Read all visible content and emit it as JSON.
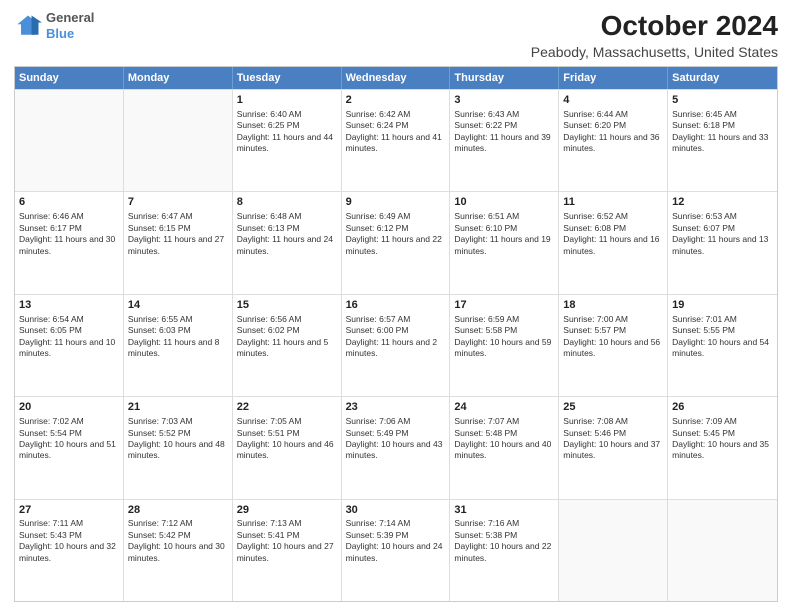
{
  "header": {
    "logo_line1": "General",
    "logo_line2": "Blue",
    "title": "October 2024",
    "subtitle": "Peabody, Massachusetts, United States"
  },
  "days_of_week": [
    "Sunday",
    "Monday",
    "Tuesday",
    "Wednesday",
    "Thursday",
    "Friday",
    "Saturday"
  ],
  "weeks": [
    [
      {
        "day": "",
        "info": ""
      },
      {
        "day": "",
        "info": ""
      },
      {
        "day": "1",
        "info": "Sunrise: 6:40 AM\nSunset: 6:25 PM\nDaylight: 11 hours and 44 minutes."
      },
      {
        "day": "2",
        "info": "Sunrise: 6:42 AM\nSunset: 6:24 PM\nDaylight: 11 hours and 41 minutes."
      },
      {
        "day": "3",
        "info": "Sunrise: 6:43 AM\nSunset: 6:22 PM\nDaylight: 11 hours and 39 minutes."
      },
      {
        "day": "4",
        "info": "Sunrise: 6:44 AM\nSunset: 6:20 PM\nDaylight: 11 hours and 36 minutes."
      },
      {
        "day": "5",
        "info": "Sunrise: 6:45 AM\nSunset: 6:18 PM\nDaylight: 11 hours and 33 minutes."
      }
    ],
    [
      {
        "day": "6",
        "info": "Sunrise: 6:46 AM\nSunset: 6:17 PM\nDaylight: 11 hours and 30 minutes."
      },
      {
        "day": "7",
        "info": "Sunrise: 6:47 AM\nSunset: 6:15 PM\nDaylight: 11 hours and 27 minutes."
      },
      {
        "day": "8",
        "info": "Sunrise: 6:48 AM\nSunset: 6:13 PM\nDaylight: 11 hours and 24 minutes."
      },
      {
        "day": "9",
        "info": "Sunrise: 6:49 AM\nSunset: 6:12 PM\nDaylight: 11 hours and 22 minutes."
      },
      {
        "day": "10",
        "info": "Sunrise: 6:51 AM\nSunset: 6:10 PM\nDaylight: 11 hours and 19 minutes."
      },
      {
        "day": "11",
        "info": "Sunrise: 6:52 AM\nSunset: 6:08 PM\nDaylight: 11 hours and 16 minutes."
      },
      {
        "day": "12",
        "info": "Sunrise: 6:53 AM\nSunset: 6:07 PM\nDaylight: 11 hours and 13 minutes."
      }
    ],
    [
      {
        "day": "13",
        "info": "Sunrise: 6:54 AM\nSunset: 6:05 PM\nDaylight: 11 hours and 10 minutes."
      },
      {
        "day": "14",
        "info": "Sunrise: 6:55 AM\nSunset: 6:03 PM\nDaylight: 11 hours and 8 minutes."
      },
      {
        "day": "15",
        "info": "Sunrise: 6:56 AM\nSunset: 6:02 PM\nDaylight: 11 hours and 5 minutes."
      },
      {
        "day": "16",
        "info": "Sunrise: 6:57 AM\nSunset: 6:00 PM\nDaylight: 11 hours and 2 minutes."
      },
      {
        "day": "17",
        "info": "Sunrise: 6:59 AM\nSunset: 5:58 PM\nDaylight: 10 hours and 59 minutes."
      },
      {
        "day": "18",
        "info": "Sunrise: 7:00 AM\nSunset: 5:57 PM\nDaylight: 10 hours and 56 minutes."
      },
      {
        "day": "19",
        "info": "Sunrise: 7:01 AM\nSunset: 5:55 PM\nDaylight: 10 hours and 54 minutes."
      }
    ],
    [
      {
        "day": "20",
        "info": "Sunrise: 7:02 AM\nSunset: 5:54 PM\nDaylight: 10 hours and 51 minutes."
      },
      {
        "day": "21",
        "info": "Sunrise: 7:03 AM\nSunset: 5:52 PM\nDaylight: 10 hours and 48 minutes."
      },
      {
        "day": "22",
        "info": "Sunrise: 7:05 AM\nSunset: 5:51 PM\nDaylight: 10 hours and 46 minutes."
      },
      {
        "day": "23",
        "info": "Sunrise: 7:06 AM\nSunset: 5:49 PM\nDaylight: 10 hours and 43 minutes."
      },
      {
        "day": "24",
        "info": "Sunrise: 7:07 AM\nSunset: 5:48 PM\nDaylight: 10 hours and 40 minutes."
      },
      {
        "day": "25",
        "info": "Sunrise: 7:08 AM\nSunset: 5:46 PM\nDaylight: 10 hours and 37 minutes."
      },
      {
        "day": "26",
        "info": "Sunrise: 7:09 AM\nSunset: 5:45 PM\nDaylight: 10 hours and 35 minutes."
      }
    ],
    [
      {
        "day": "27",
        "info": "Sunrise: 7:11 AM\nSunset: 5:43 PM\nDaylight: 10 hours and 32 minutes."
      },
      {
        "day": "28",
        "info": "Sunrise: 7:12 AM\nSunset: 5:42 PM\nDaylight: 10 hours and 30 minutes."
      },
      {
        "day": "29",
        "info": "Sunrise: 7:13 AM\nSunset: 5:41 PM\nDaylight: 10 hours and 27 minutes."
      },
      {
        "day": "30",
        "info": "Sunrise: 7:14 AM\nSunset: 5:39 PM\nDaylight: 10 hours and 24 minutes."
      },
      {
        "day": "31",
        "info": "Sunrise: 7:16 AM\nSunset: 5:38 PM\nDaylight: 10 hours and 22 minutes."
      },
      {
        "day": "",
        "info": ""
      },
      {
        "day": "",
        "info": ""
      }
    ]
  ]
}
